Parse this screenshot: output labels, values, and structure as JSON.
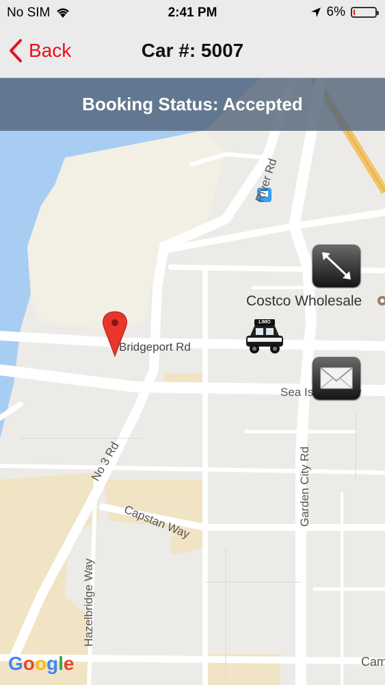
{
  "status_bar": {
    "carrier": "No SIM",
    "time": "2:41 PM",
    "battery_text": "6%",
    "battery_level": 0.06,
    "wifi_icon": "wifi-icon",
    "location_icon": "location-arrow-icon"
  },
  "nav": {
    "back_label": "Back",
    "title": "Car #: 5007"
  },
  "booking": {
    "status_text": "Booking Status: Accepted"
  },
  "map": {
    "labels": {
      "river_rd": "River Rd",
      "costco": "Costco Wholesale",
      "bridgeport_rd": "Bridgeport Rd",
      "sea_island_way": "Sea Island Way",
      "no3_rd": "No 3 Rd",
      "garden_city_rd": "Garden City Rd",
      "capstan_way": "Capstan Way",
      "hazelbridge_way": "Hazelbridge Way",
      "cam": "Cam"
    },
    "car_badge": "LIMO",
    "google_logo": [
      "G",
      "o",
      "o",
      "g",
      "l",
      "e"
    ]
  },
  "colors": {
    "accent": "#e8111a",
    "water": "#a7cdf2",
    "park": "#f2efe4",
    "sand": "#f1e4c4",
    "road": "#ffffff"
  }
}
